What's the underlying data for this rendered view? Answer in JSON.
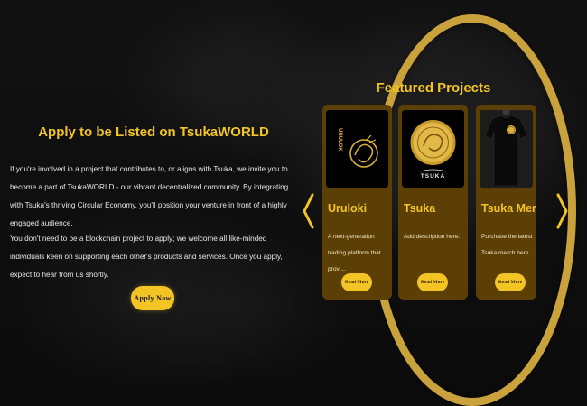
{
  "apply": {
    "title": "Apply to be Listed on TsukaWORLD",
    "paragraph1": "If you're involved in a project that contributes to, or aligns with Tsuka, we invite you to become a part of TsukaWORLD - our vibrant decentralized community. By integrating with Tsuka's thriving Circular Economy, you'll position your venture in front of a highly engaged audience.",
    "paragraph2": "You don't need to be a blockchain project to apply; we welcome all like-minded individuals keen on supporting each other's products and services. Once you apply, expect to hear from us shortly.",
    "button_label": "Apply Now"
  },
  "featured": {
    "title": "Featured Projects",
    "prev_icon": "chevron-left-icon",
    "next_icon": "chevron-right-icon",
    "image_text": {
      "uruloki_side": "URULOKI",
      "tsuka_logo": "TSUKA"
    },
    "cards": [
      {
        "name": "Uruloki",
        "description": "A next-generation trading platform that provi...",
        "button_label": "Read More",
        "image_icon": "uruloki-logo-icon"
      },
      {
        "name": "Tsuka",
        "description": "Add description here.",
        "button_label": "Read More",
        "image_icon": "tsuka-coin-icon"
      },
      {
        "name": "Tsuka Merch",
        "description": "Purchase the latest Tsuka merch here",
        "button_label": "Read More",
        "image_icon": "tshirt-icon"
      }
    ]
  },
  "colors": {
    "accent": "#f2c524",
    "card_bg": "#5b3f05",
    "ring": "#c9a23c",
    "background": "#141414"
  }
}
